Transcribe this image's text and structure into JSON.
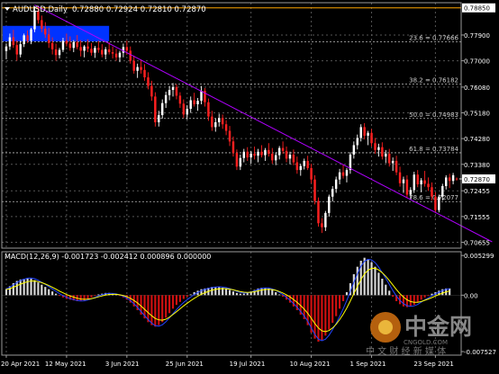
{
  "chart_title": {
    "symbol_timeframe": "AUDUSD,Daily",
    "ohlc": "0.72880 0.72924 0.72810 0.72870"
  },
  "macd_header": "MACD(12,26,9) -0.001723 -0.002412 0.000896 0.000000",
  "watermark": {
    "brand": "中金网",
    "subtitle": "中 文 财 经 新 媒 体",
    "url": "CNGOLD.COM"
  },
  "colors": {
    "background": "#000000",
    "frame": "#9a9a9a",
    "grid": "#555555",
    "bull": "#ffffff",
    "bear": "#ff2020",
    "trendline": "#b000ff",
    "fib_lines": "#bbbbbb",
    "fib_labels": "#cfcfcf",
    "hline": "#ffa500",
    "zone": "#0033ff",
    "macd_hist_pos": "#d8d8d8",
    "macd_hist_neg": "#d01010",
    "macd_signal": "#ffff00",
    "macd_line": "#2244ff"
  },
  "chart_data": {
    "type": "candlestick",
    "symbol": "AUDUSD",
    "timeframe": "Daily",
    "current_price": "0.72870",
    "horizontal_line": "0.78850",
    "y_axis_ticks": [
      "0.77900",
      "0.77000",
      "0.76080",
      "0.75180",
      "0.74280",
      "0.73380",
      "0.72455",
      "0.71555",
      "0.70655"
    ],
    "y_range": [
      0.7045,
      0.7903
    ],
    "x_axis_ticks": [
      "20 Apr 2021",
      "12 May 2021",
      "3 Jun 2021",
      "25 Jun 2021",
      "19 Jul 2021",
      "10 Aug 2021",
      "1 Sep 2021",
      "23 Sep 2021"
    ],
    "fibonacci": [
      {
        "label": "23.6 = 0.77666",
        "value": 0.77666
      },
      {
        "label": "38.2 = 0.76182",
        "value": 0.76182
      },
      {
        "label": "50.0 = 0.74983",
        "value": 0.74983
      },
      {
        "label": "61.8 = 0.73784",
        "value": 0.73784
      },
      {
        "label": "78.6 = 0.72077",
        "value": 0.72077
      }
    ],
    "resistance_zone": [
      0.7768,
      0.7822
    ],
    "trendline": [
      {
        "bar": 8,
        "price": 0.7895
      },
      {
        "bar": 137,
        "price": 0.7067
      }
    ],
    "ohlc": [
      [
        0.7734,
        0.776,
        0.7705,
        0.775
      ],
      [
        0.775,
        0.7795,
        0.7738,
        0.7782
      ],
      [
        0.7782,
        0.7808,
        0.7745,
        0.7755
      ],
      [
        0.7755,
        0.7772,
        0.77,
        0.7722
      ],
      [
        0.7722,
        0.777,
        0.7712,
        0.7758
      ],
      [
        0.7758,
        0.7795,
        0.7748,
        0.7789
      ],
      [
        0.7789,
        0.7806,
        0.7762,
        0.777
      ],
      [
        0.777,
        0.7815,
        0.7758,
        0.781
      ],
      [
        0.781,
        0.789,
        0.78,
        0.7875
      ],
      [
        0.7875,
        0.7892,
        0.783,
        0.7842
      ],
      [
        0.7842,
        0.7858,
        0.78,
        0.7812
      ],
      [
        0.7812,
        0.7835,
        0.778,
        0.7792
      ],
      [
        0.7792,
        0.7815,
        0.7745,
        0.7762
      ],
      [
        0.7762,
        0.7782,
        0.7722,
        0.774
      ],
      [
        0.774,
        0.776,
        0.77,
        0.772
      ],
      [
        0.772,
        0.7745,
        0.7708,
        0.7738
      ],
      [
        0.7738,
        0.778,
        0.773,
        0.777
      ],
      [
        0.777,
        0.7795,
        0.775,
        0.776
      ],
      [
        0.776,
        0.7785,
        0.7735,
        0.7745
      ],
      [
        0.7745,
        0.7772,
        0.773,
        0.7765
      ],
      [
        0.7765,
        0.779,
        0.774,
        0.7748
      ],
      [
        0.7748,
        0.7772,
        0.7715,
        0.7735
      ],
      [
        0.7735,
        0.7755,
        0.7712,
        0.775
      ],
      [
        0.775,
        0.7775,
        0.773,
        0.7742
      ],
      [
        0.7742,
        0.7762,
        0.7718,
        0.7728
      ],
      [
        0.7728,
        0.7752,
        0.771,
        0.7745
      ],
      [
        0.7745,
        0.777,
        0.7728,
        0.7738
      ],
      [
        0.7738,
        0.7758,
        0.7712,
        0.7722
      ],
      [
        0.7722,
        0.7748,
        0.7705,
        0.774
      ],
      [
        0.774,
        0.7765,
        0.7722,
        0.773
      ],
      [
        0.773,
        0.775,
        0.7708,
        0.7725
      ],
      [
        0.7725,
        0.7742,
        0.77,
        0.7712
      ],
      [
        0.7712,
        0.7735,
        0.7695,
        0.7728
      ],
      [
        0.7728,
        0.776,
        0.7712,
        0.7748
      ],
      [
        0.7748,
        0.777,
        0.772,
        0.7735
      ],
      [
        0.7735,
        0.775,
        0.769,
        0.77
      ],
      [
        0.77,
        0.7718,
        0.7655,
        0.7665
      ],
      [
        0.7665,
        0.769,
        0.764,
        0.7678
      ],
      [
        0.7678,
        0.7705,
        0.7655,
        0.7668
      ],
      [
        0.7668,
        0.7688,
        0.763,
        0.7642
      ],
      [
        0.7642,
        0.766,
        0.76,
        0.7612
      ],
      [
        0.7612,
        0.763,
        0.756,
        0.7575
      ],
      [
        0.7575,
        0.759,
        0.747,
        0.7485
      ],
      [
        0.7485,
        0.7525,
        0.747,
        0.751
      ],
      [
        0.751,
        0.7565,
        0.7498,
        0.7552
      ],
      [
        0.7552,
        0.7592,
        0.7535,
        0.758
      ],
      [
        0.758,
        0.7612,
        0.7562,
        0.7598
      ],
      [
        0.7598,
        0.7622,
        0.7575,
        0.7608
      ],
      [
        0.7608,
        0.7618,
        0.7565,
        0.7578
      ],
      [
        0.7578,
        0.759,
        0.7535,
        0.755
      ],
      [
        0.755,
        0.7565,
        0.75,
        0.7512
      ],
      [
        0.7512,
        0.7545,
        0.7495,
        0.7532
      ],
      [
        0.7532,
        0.7575,
        0.7518,
        0.7562
      ],
      [
        0.7562,
        0.7588,
        0.754,
        0.7548
      ],
      [
        0.7548,
        0.757,
        0.7525,
        0.756
      ],
      [
        0.756,
        0.7612,
        0.7548,
        0.7595
      ],
      [
        0.7595,
        0.7605,
        0.754,
        0.7555
      ],
      [
        0.7555,
        0.7568,
        0.749,
        0.7505
      ],
      [
        0.7505,
        0.7525,
        0.7455,
        0.7468
      ],
      [
        0.7468,
        0.7498,
        0.7452,
        0.7485
      ],
      [
        0.7485,
        0.7515,
        0.747,
        0.75
      ],
      [
        0.75,
        0.7512,
        0.7462,
        0.7478
      ],
      [
        0.7478,
        0.7492,
        0.744,
        0.7455
      ],
      [
        0.7455,
        0.7472,
        0.7402,
        0.7418
      ],
      [
        0.7418,
        0.7435,
        0.7365,
        0.7378
      ],
      [
        0.7378,
        0.739,
        0.7318,
        0.733
      ],
      [
        0.733,
        0.7372,
        0.7318,
        0.736
      ],
      [
        0.736,
        0.7392,
        0.7345,
        0.7382
      ],
      [
        0.7382,
        0.7398,
        0.735,
        0.7362
      ],
      [
        0.7362,
        0.7385,
        0.734,
        0.7375
      ],
      [
        0.7375,
        0.74,
        0.7355,
        0.7368
      ],
      [
        0.7368,
        0.7392,
        0.7345,
        0.7382
      ],
      [
        0.7382,
        0.7405,
        0.7362,
        0.737
      ],
      [
        0.737,
        0.7395,
        0.735,
        0.7388
      ],
      [
        0.7388,
        0.7412,
        0.7365,
        0.7375
      ],
      [
        0.7375,
        0.7395,
        0.734,
        0.7352
      ],
      [
        0.7352,
        0.738,
        0.7335,
        0.737
      ],
      [
        0.737,
        0.7402,
        0.7355,
        0.7395
      ],
      [
        0.7395,
        0.7418,
        0.7375,
        0.7385
      ],
      [
        0.7385,
        0.74,
        0.7345,
        0.7358
      ],
      [
        0.7358,
        0.7382,
        0.7338,
        0.7372
      ],
      [
        0.7372,
        0.739,
        0.7335,
        0.7345
      ],
      [
        0.7345,
        0.7365,
        0.7305,
        0.7318
      ],
      [
        0.7318,
        0.734,
        0.7298,
        0.7332
      ],
      [
        0.7332,
        0.7358,
        0.732,
        0.735
      ],
      [
        0.735,
        0.7368,
        0.7318,
        0.7325
      ],
      [
        0.7325,
        0.734,
        0.7272,
        0.7285
      ],
      [
        0.7285,
        0.73,
        0.7198,
        0.721
      ],
      [
        0.721,
        0.7222,
        0.712,
        0.7132
      ],
      [
        0.7132,
        0.715,
        0.7098,
        0.7118
      ],
      [
        0.7118,
        0.7175,
        0.7105,
        0.7168
      ],
      [
        0.7168,
        0.7232,
        0.7155,
        0.7225
      ],
      [
        0.7225,
        0.7262,
        0.7208,
        0.7252
      ],
      [
        0.7252,
        0.7295,
        0.7238,
        0.7285
      ],
      [
        0.7285,
        0.7322,
        0.7268,
        0.731
      ],
      [
        0.731,
        0.7338,
        0.7288,
        0.7298
      ],
      [
        0.7298,
        0.7325,
        0.7275,
        0.7318
      ],
      [
        0.7318,
        0.738,
        0.7305,
        0.7372
      ],
      [
        0.7372,
        0.7418,
        0.7358,
        0.7405
      ],
      [
        0.7405,
        0.7442,
        0.739,
        0.743
      ],
      [
        0.743,
        0.7478,
        0.7418,
        0.7468
      ],
      [
        0.7468,
        0.7482,
        0.7425,
        0.7438
      ],
      [
        0.7438,
        0.7455,
        0.7405,
        0.7448
      ],
      [
        0.7448,
        0.7462,
        0.74,
        0.7412
      ],
      [
        0.7412,
        0.743,
        0.7375,
        0.7388
      ],
      [
        0.7388,
        0.741,
        0.7365,
        0.7398
      ],
      [
        0.7398,
        0.7415,
        0.7355,
        0.7365
      ],
      [
        0.7365,
        0.7388,
        0.7342,
        0.7375
      ],
      [
        0.7375,
        0.7392,
        0.733,
        0.7342
      ],
      [
        0.7342,
        0.7362,
        0.7315,
        0.735
      ],
      [
        0.735,
        0.7368,
        0.73,
        0.731
      ],
      [
        0.731,
        0.733,
        0.726,
        0.7272
      ],
      [
        0.7272,
        0.7295,
        0.7238,
        0.7285
      ],
      [
        0.7285,
        0.73,
        0.722,
        0.7232
      ],
      [
        0.7232,
        0.7258,
        0.7215,
        0.7248
      ],
      [
        0.7248,
        0.7312,
        0.7238,
        0.7302
      ],
      [
        0.7302,
        0.7318,
        0.7258,
        0.7268
      ],
      [
        0.7268,
        0.729,
        0.724,
        0.7282
      ],
      [
        0.7282,
        0.7315,
        0.726,
        0.727
      ],
      [
        0.727,
        0.7292,
        0.7245,
        0.7258
      ],
      [
        0.7258,
        0.7275,
        0.7212,
        0.7225
      ],
      [
        0.7225,
        0.724,
        0.7168,
        0.7178
      ],
      [
        0.7178,
        0.7232,
        0.717,
        0.7225
      ],
      [
        0.7225,
        0.727,
        0.7212,
        0.7262
      ],
      [
        0.7262,
        0.73,
        0.725,
        0.7292
      ],
      [
        0.7292,
        0.7305,
        0.7255,
        0.728
      ],
      [
        0.728,
        0.7308,
        0.7268,
        0.73
      ],
      [
        0.7288,
        0.7292,
        0.7281,
        0.7287
      ]
    ],
    "macd_pane": {
      "label": "MACD(12,26,9)",
      "values": {
        "macd": -0.001723,
        "signal": -0.002412,
        "osma": 0.000896,
        "extra": 0.0
      },
      "y_axis_ticks": [
        "0.005299",
        "0.00",
        "-0.007527"
      ],
      "y_range": [
        -0.008,
        0.0058
      ],
      "histogram": [
        0.0008,
        0.0012,
        0.0016,
        0.0019,
        0.0021,
        0.0022,
        0.0023,
        0.0022,
        0.002,
        0.0017,
        0.0014,
        0.0011,
        0.0008,
        0.0005,
        0.0002,
        -0.0001,
        -0.0003,
        -0.0005,
        -0.0006,
        -0.0007,
        -0.0008,
        -0.0008,
        -0.0007,
        -0.0005,
        -0.0003,
        -0.0001,
        0.0001,
        0.0002,
        0.0003,
        0.0003,
        0.0002,
        0.0001,
        -0.0001,
        -0.0003,
        -0.0006,
        -0.001,
        -0.0015,
        -0.002,
        -0.0026,
        -0.0031,
        -0.0036,
        -0.004,
        -0.0042,
        -0.004,
        -0.0036,
        -0.003,
        -0.0024,
        -0.0018,
        -0.0013,
        -0.0009,
        -0.0005,
        -0.0002,
        0.0001,
        0.0004,
        0.0006,
        0.0008,
        0.0009,
        0.001,
        0.0011,
        0.0011,
        0.0011,
        0.001,
        0.0009,
        0.0007,
        0.0005,
        0.0003,
        0.0002,
        0.0002,
        0.0003,
        0.0005,
        0.0007,
        0.0009,
        0.001,
        0.001,
        0.0009,
        0.0007,
        0.0004,
        0.0001,
        -0.0002,
        -0.0006,
        -0.001,
        -0.0015,
        -0.002,
        -0.0026,
        -0.0032,
        -0.004,
        -0.005,
        -0.0058,
        -0.0062,
        -0.006,
        -0.0054,
        -0.0046,
        -0.0037,
        -0.0028,
        -0.0018,
        -0.0008,
        0.0004,
        0.0016,
        0.0028,
        0.0038,
        0.0046,
        0.005,
        0.0048,
        0.0044,
        0.0038,
        0.003,
        0.0022,
        0.0014,
        0.0006,
        -0.0002,
        -0.0008,
        -0.0012,
        -0.0015,
        -0.0016,
        -0.0015,
        -0.0013,
        -0.001,
        -0.0006,
        -0.0003,
        -0.0001,
        0.0002,
        0.0004,
        0.0006,
        0.0008,
        0.0009,
        0.0009
      ]
    }
  }
}
